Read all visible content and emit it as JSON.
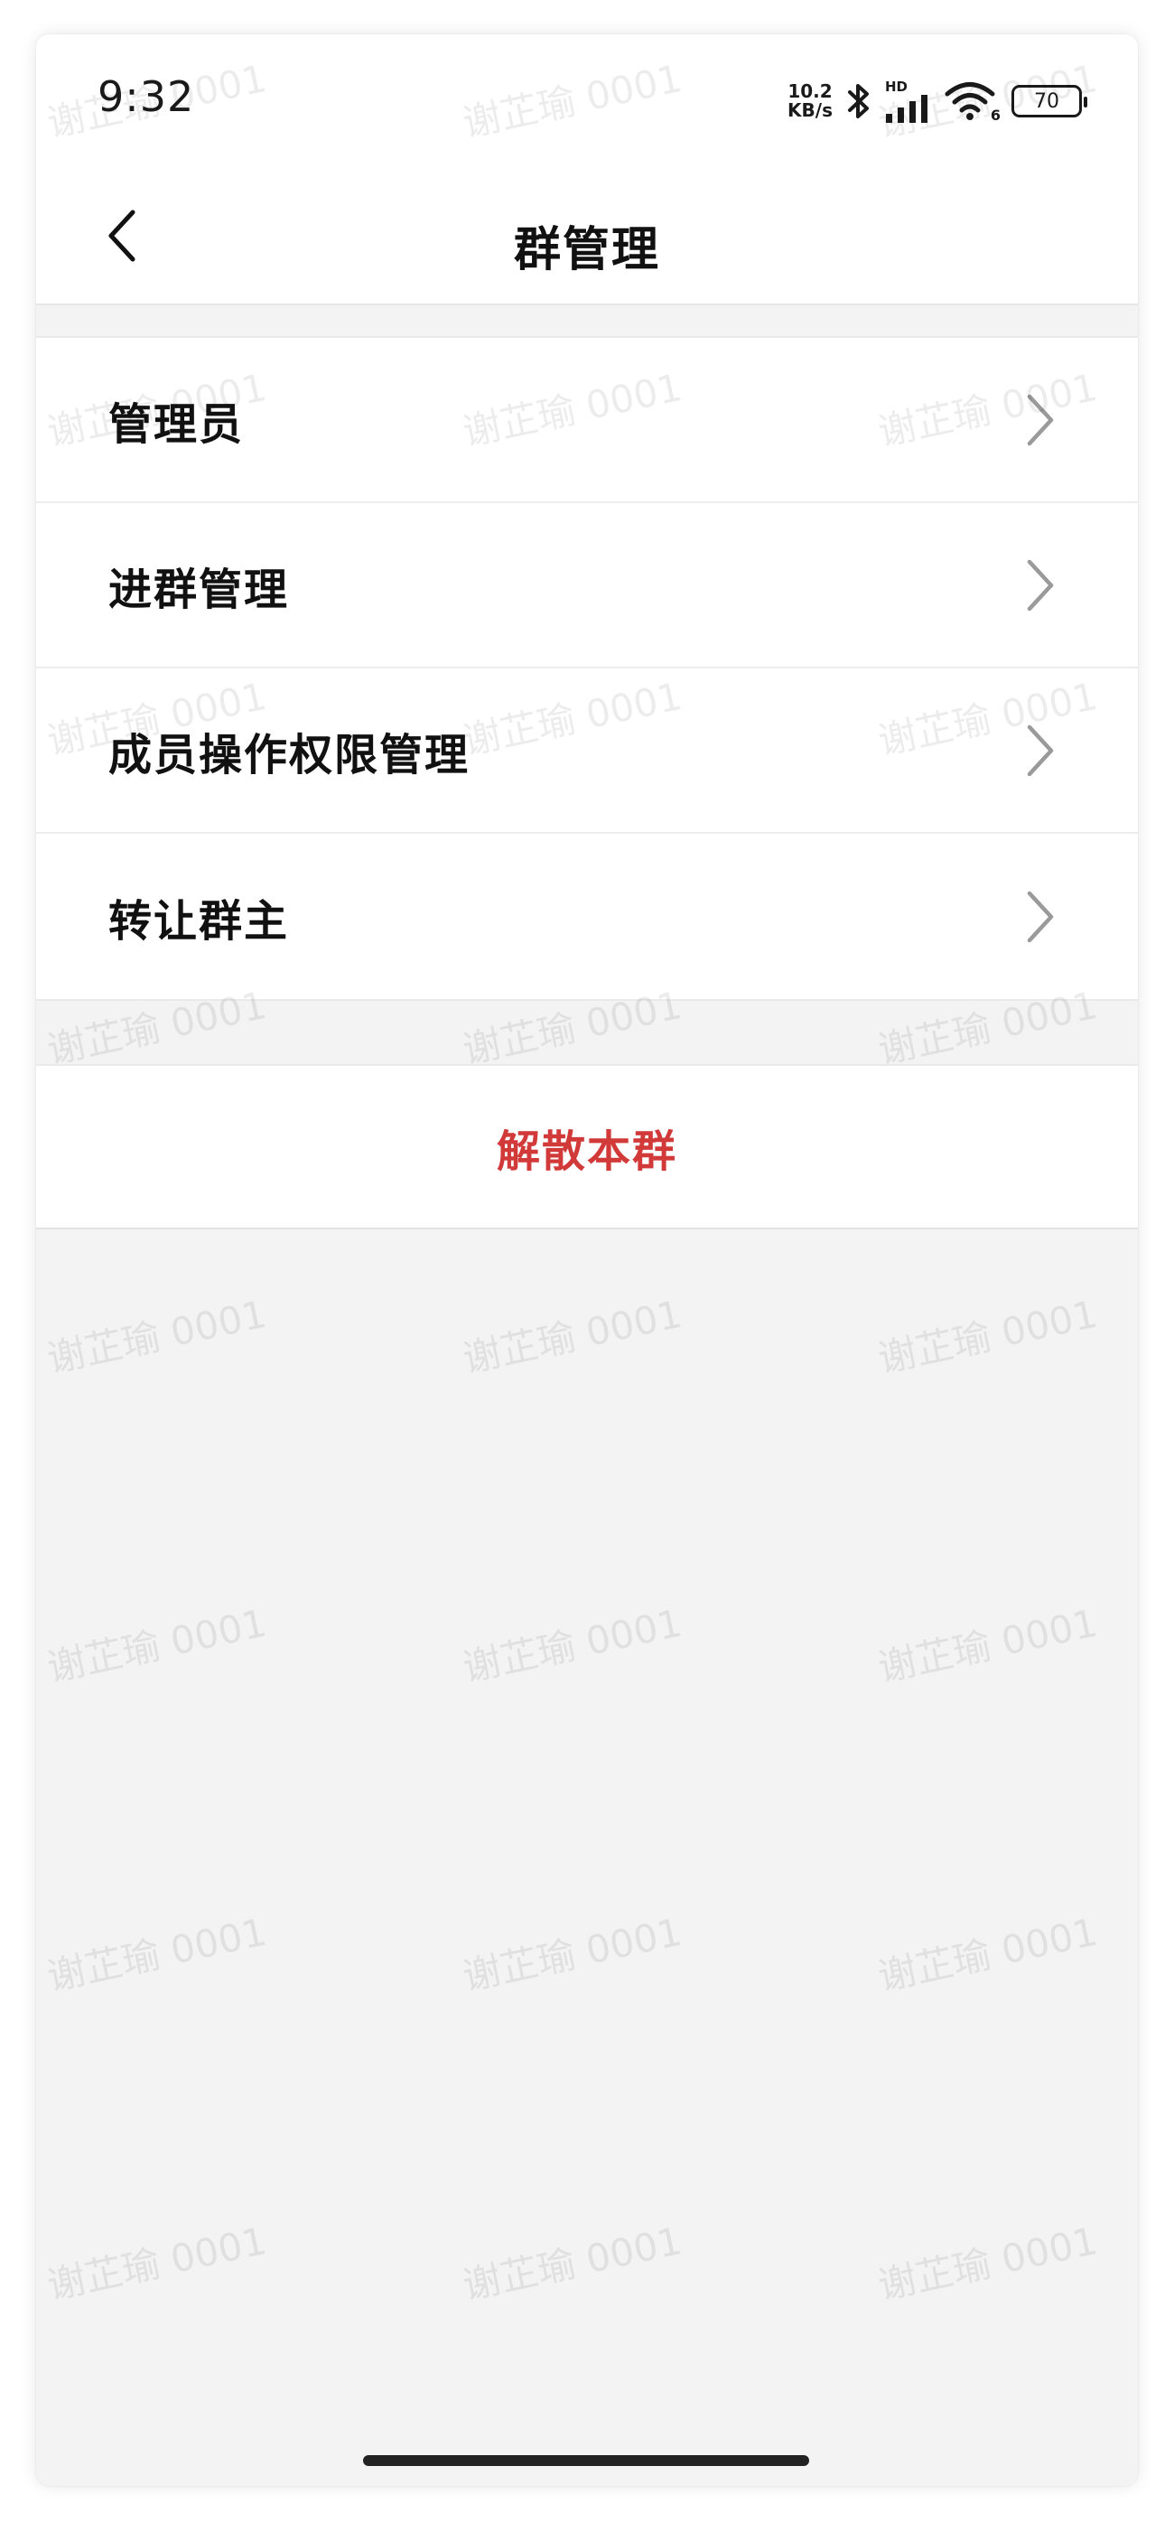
{
  "status_bar": {
    "time": "9:32",
    "net_speed_value": "10.2",
    "net_speed_unit": "KB/s",
    "hd_label": "HD",
    "wifi_badge": "6",
    "battery": "70",
    "icons": [
      "bluetooth-icon",
      "signal-icon",
      "wifi-icon",
      "battery-icon"
    ]
  },
  "nav": {
    "title": "群管理",
    "back_icon": "back-chevron-icon"
  },
  "menu": {
    "items": [
      {
        "label": "管理员"
      },
      {
        "label": "进群管理"
      },
      {
        "label": "成员操作权限管理"
      },
      {
        "label": "转让群主"
      }
    ]
  },
  "danger_action": {
    "label": "解散本群",
    "color": "#d23a3a"
  },
  "watermark": {
    "text": "谢芷瑜 0001"
  }
}
